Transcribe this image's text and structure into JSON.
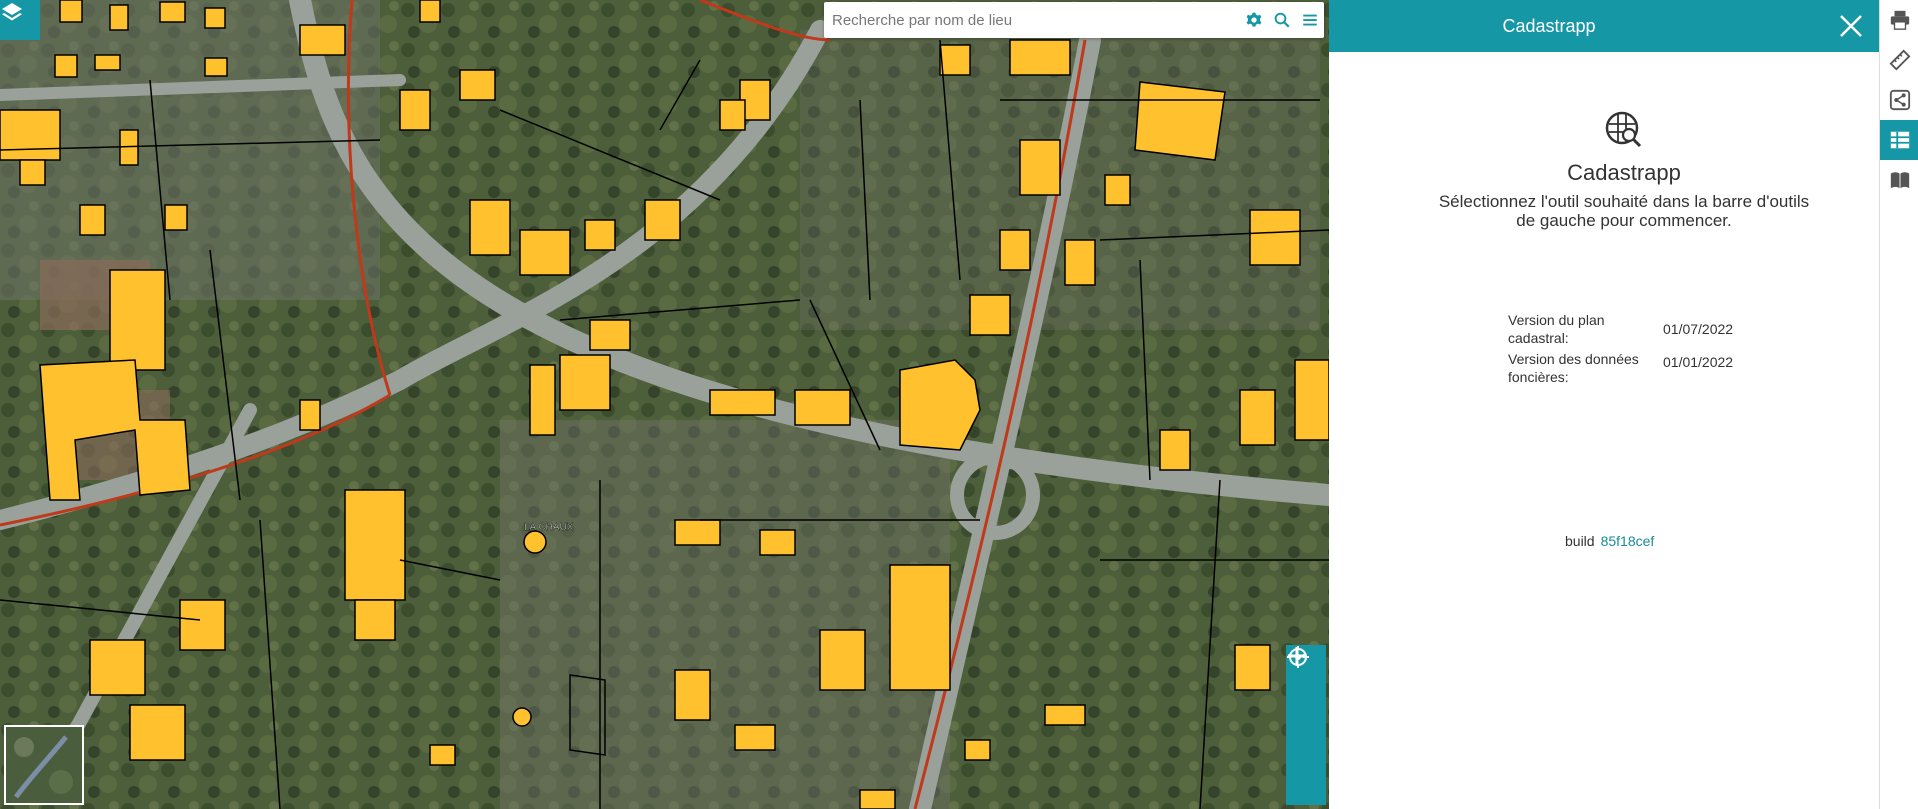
{
  "search": {
    "placeholder": "Recherche par nom de lieu"
  },
  "map": {
    "place_label": "LA CHAUX"
  },
  "panel": {
    "title": "Cadastrapp",
    "app_name": "Cadastrapp",
    "intro": "Sélectionnez l'outil souhaité dans la barre d'outils de gauche pour commencer.",
    "versions": [
      {
        "label": "Version du plan cadastral:",
        "value": "01/07/2022"
      },
      {
        "label": "Version des données foncières:",
        "value": "01/01/2022"
      }
    ],
    "build_label": "build",
    "build_value": "85f18cef"
  },
  "colors": {
    "accent": "#1697a6",
    "active": "#3d9e3f",
    "building": "#ffc12e",
    "road_red": "#c0391b"
  },
  "icons": {
    "layers": "layers-icon",
    "tools": [
      "expand-icon",
      "point-icon",
      "line-icon",
      "polygon-icon",
      "list-icon",
      "search-icon",
      "table-icon",
      "gear-icon",
      "help-icon"
    ],
    "map_controls": [
      "locate-icon",
      "zoom-in-icon",
      "zoom-out-icon",
      "more-icon"
    ],
    "right_bar": [
      "print-icon",
      "measure-icon",
      "share-icon",
      "table-icon",
      "book-icon"
    ]
  }
}
